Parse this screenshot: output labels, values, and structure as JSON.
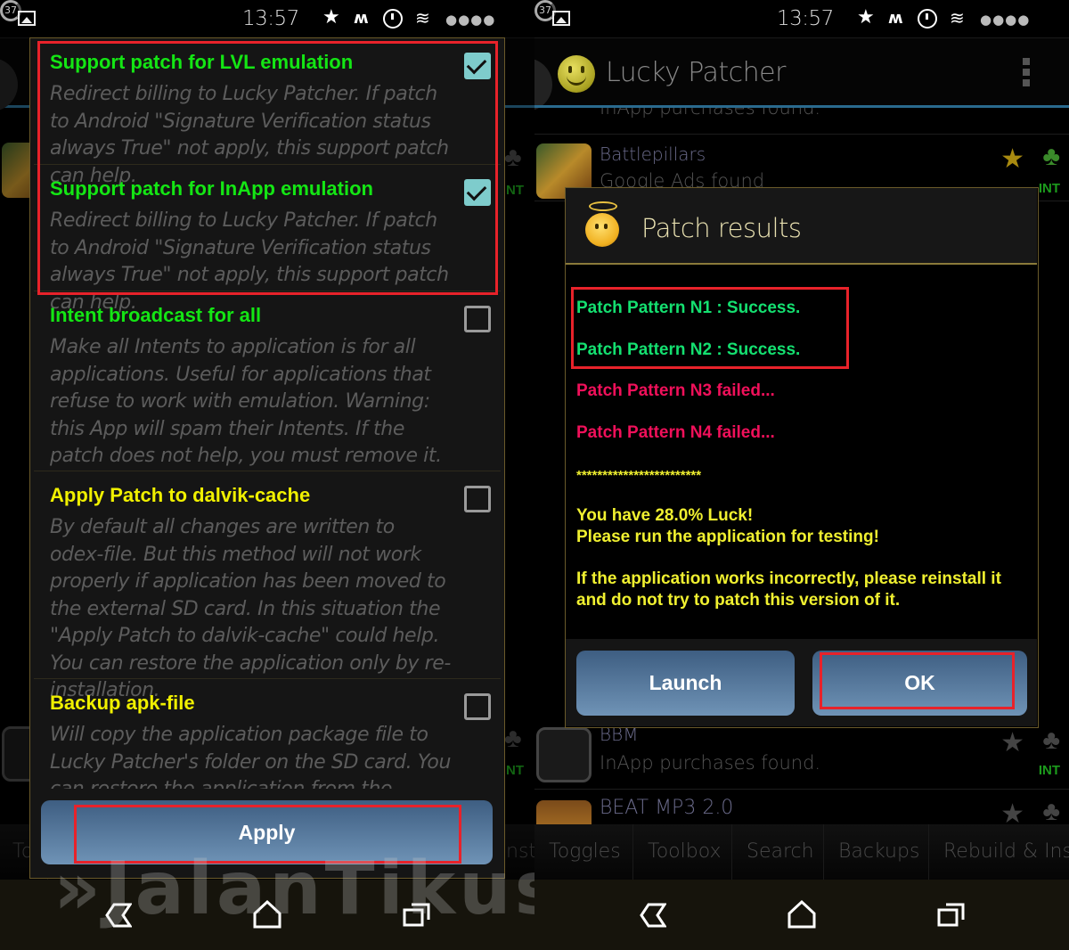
{
  "status_bar": {
    "time": "13:57",
    "battery_level": "37",
    "icons": [
      "gallery-icon",
      "star-icon",
      "signal-wave-icon",
      "alarm-icon",
      "wifi-icon",
      "signal-dots-icon",
      "battery-icon"
    ],
    "star_glyph": "★",
    "wave_glyph": "ᴡ",
    "wifi_glyph": "≋",
    "dots_glyph": "●●●●"
  },
  "left_screen": {
    "options": [
      {
        "title": "Support patch for LVL emulation",
        "description": "Redirect billing to Lucky Patcher. If patch to Android \"Signature Verification status always True\" not apply, this support patch can help.",
        "checked": true,
        "title_color": "green"
      },
      {
        "title": "Support patch for InApp emulation",
        "description": "Redirect billing to Lucky Patcher. If patch to Android \"Signature Verification status always True\" not apply, this support patch can help.",
        "checked": true,
        "title_color": "green"
      },
      {
        "title": "Intent broadcast for all",
        "description": "Make all Intents to application is for all applications. Useful for applications that refuse to work with emulation. Warning: this App will spam their Intents. If the patch does not help, you must remove it.",
        "checked": false,
        "title_color": "green"
      },
      {
        "title": "Apply Patch to dalvik-cache",
        "description": "By default all changes are written to odex-file. But this method will not work properly if application has been moved to the external SD card. In this situation the \"Apply Patch to dalvik-cache\" could help. You can restore the application only by re-installation.",
        "checked": false,
        "title_color": "yellow"
      },
      {
        "title": "Backup apk-file",
        "description": "Will copy the application package file to Lucky Patcher's folder on the SD card. You can restore the application from the copied apk",
        "checked": false,
        "title_color": "yellow"
      }
    ],
    "apply_button": "Apply",
    "bg_tab_left_fragment": "To",
    "bg_tab_right_fragment": "nsta",
    "bg_int_label": "NT",
    "watermark": "»JalanTikus"
  },
  "right_screen": {
    "app_title": "Lucky Patcher",
    "list_items": [
      {
        "name": "",
        "status": "InApp purchases found."
      },
      {
        "name": "Battlepillars",
        "status": "Google Ads found",
        "badge": "INT"
      },
      {
        "name": "BBM",
        "status": "InApp purchases found.",
        "badge": "INT"
      },
      {
        "name": "BEAT MP3 2.0",
        "status": ""
      }
    ],
    "dialog": {
      "title": "Patch results",
      "results": [
        {
          "text": "Patch Pattern N1 : Success.",
          "status": "success"
        },
        {
          "text": "Patch Pattern N2 : Success.",
          "status": "success"
        },
        {
          "text": "Patch Pattern N3 failed...",
          "status": "failed"
        },
        {
          "text": "Patch Pattern N4 failed...",
          "status": "failed"
        }
      ],
      "separator": "************************",
      "luck_line": "You have 28.0% Luck!",
      "run_line": "Please run the application for testing!",
      "warning_line1": "If the application works incorrectly, please reinstall it",
      "warning_line2": "and do not try to patch this version of it.",
      "launch_button": "Launch",
      "ok_button": "OK"
    },
    "tabs": [
      "Toggles",
      "Toolbox",
      "Search",
      "Backups",
      "Rebuild & Insta"
    ]
  },
  "colors": {
    "success": "#14e070",
    "failed": "#f0105a",
    "info": "#f0f030",
    "option_green": "#14e614",
    "option_yellow": "#f0f000",
    "highlight": "#e8222a",
    "checkbox_on": "#7ecccc",
    "dialog_border": "#6a5a2a",
    "actionbar_line": "#2a6a8e"
  }
}
